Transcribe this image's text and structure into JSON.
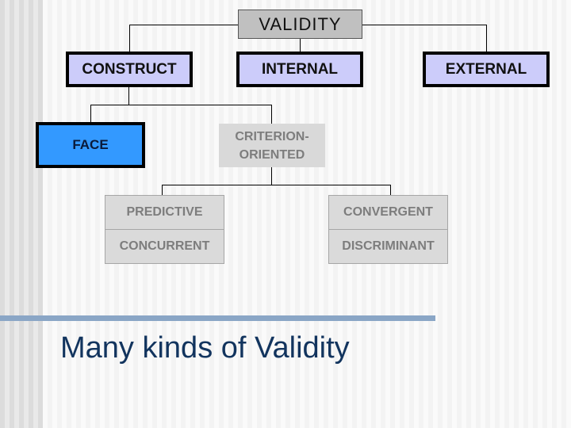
{
  "slide": {
    "title": "Many kinds of Validity",
    "colors": {
      "root_fill": "#c0c0c0",
      "level1_fill": "#ccccfa",
      "face_fill": "#3399ff",
      "muted_fill": "#d9d9d9",
      "muted_text": "#7d7d7d",
      "title_text": "#12345e",
      "accent_bar": "#8aa6c6"
    }
  },
  "tree": {
    "root": "VALIDITY",
    "level1": [
      "CONSTRUCT",
      "INTERNAL",
      "EXTERNAL"
    ],
    "construct_children": {
      "face": "FACE",
      "criterion": [
        "CRITERION-",
        "ORIENTED"
      ]
    },
    "criterion_children": {
      "left": [
        "PREDICTIVE",
        "CONCURRENT"
      ],
      "right": [
        "CONVERGENT",
        "DISCRIMINANT"
      ]
    }
  }
}
